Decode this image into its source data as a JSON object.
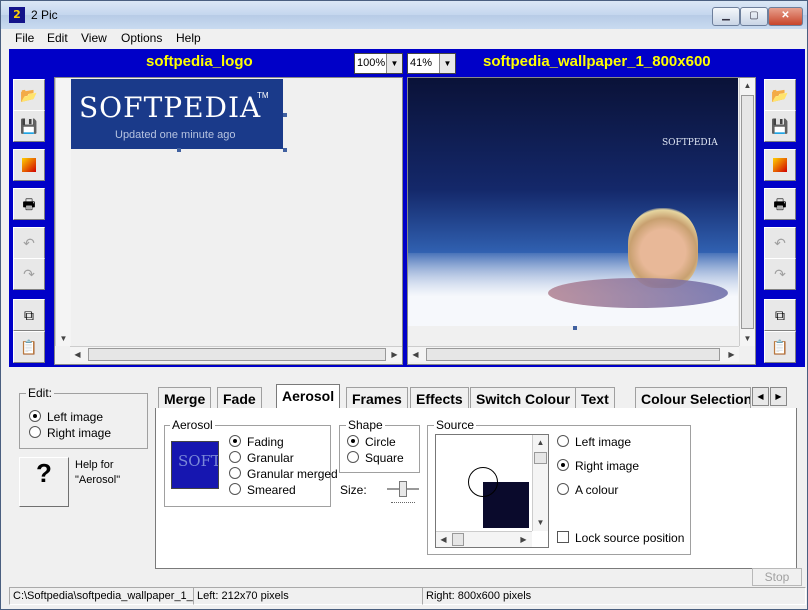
{
  "window": {
    "title": "2 Pic",
    "icon": "app-icon",
    "icon_text": "2"
  },
  "menu": [
    "File",
    "Edit",
    "View",
    "Options",
    "Help"
  ],
  "left": {
    "filename": "softpedia_logo",
    "zoom": "100%",
    "logo_text": "SOFTPEDIA",
    "tm": "TM",
    "logo_sub": "Updated one minute ago"
  },
  "right": {
    "filename": "softpedia_wallpaper_1_800x600",
    "zoom": "41%",
    "wp_text": "SOFTPEDIA"
  },
  "toolbar": [
    "open-icon",
    "save-icon",
    "colour-icon",
    "print-icon",
    "undo-icon",
    "redo-icon",
    "copy-icon",
    "paste-icon"
  ],
  "edit_group": {
    "label": "Edit:",
    "options": [
      "Left image",
      "Right image"
    ],
    "selected": "Left image"
  },
  "help": {
    "button": "?",
    "text": "Help for \"Aerosol\""
  },
  "tabs": [
    "Merge",
    "Fade",
    "Aerosol",
    "Frames",
    "Effects",
    "Switch Colour",
    "Text",
    "Colour Selection"
  ],
  "active_tab": "Aerosol",
  "aerosol": {
    "label": "Aerosol",
    "options": [
      "Fading",
      "Granular",
      "Granular merged",
      "Smeared"
    ],
    "selected": "Fading",
    "preview_text": "SOFTPEDIA"
  },
  "shape": {
    "label": "Shape",
    "options": [
      "Circle",
      "Square"
    ],
    "selected": "Circle",
    "size_label": "Size:"
  },
  "source": {
    "label": "Source",
    "options": [
      "Left image",
      "Right image",
      "A colour"
    ],
    "selected": "Right image",
    "lock": "Lock source position"
  },
  "stop": "Stop",
  "status": {
    "path": "C:\\Softpedia\\softpedia_wallpaper_1_",
    "left": "Left: 212x70 pixels",
    "right": "Right: 800x600 pixels"
  },
  "colors": {
    "panel_bg": "#0000c8",
    "filename": "#ffff00",
    "logo_bg": "#1a3a8a"
  }
}
